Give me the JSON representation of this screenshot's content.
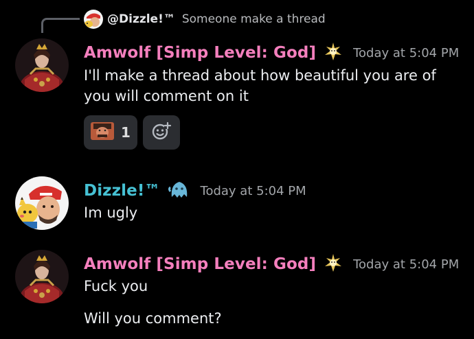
{
  "reply": {
    "author": "@Dizzle!™",
    "text": "Someone make a thread"
  },
  "messages": [
    {
      "author": "Amwolf [Simp Level: God]",
      "timestamp": "Today at 5:04 PM",
      "lines": [
        "I'll make a thread about how beautiful you are of you will comment on it"
      ],
      "reaction": {
        "emoji": "face-emoji",
        "count": "1"
      }
    },
    {
      "author": "Dizzle!™",
      "timestamp": "Today at 5:04 PM",
      "lines": [
        "Im ugly"
      ]
    },
    {
      "author": "Amwolf [Simp Level: God]",
      "timestamp": "Today at 5:04 PM",
      "lines": [
        "Fuck you",
        "Will you comment?"
      ]
    }
  ],
  "colors": {
    "background": "#000000",
    "amwolf_name": "#f47fbd",
    "dizzle_name": "#46c1d4",
    "timestamp": "#a3a6aa",
    "reaction_bg": "#2b2d31"
  },
  "icons": {
    "role_icon_amwolf": "sparkle-creature-icon",
    "role_icon_dizzle": "blue-ghost-icon",
    "add_reaction": "add-reaction-smiley-icon"
  }
}
